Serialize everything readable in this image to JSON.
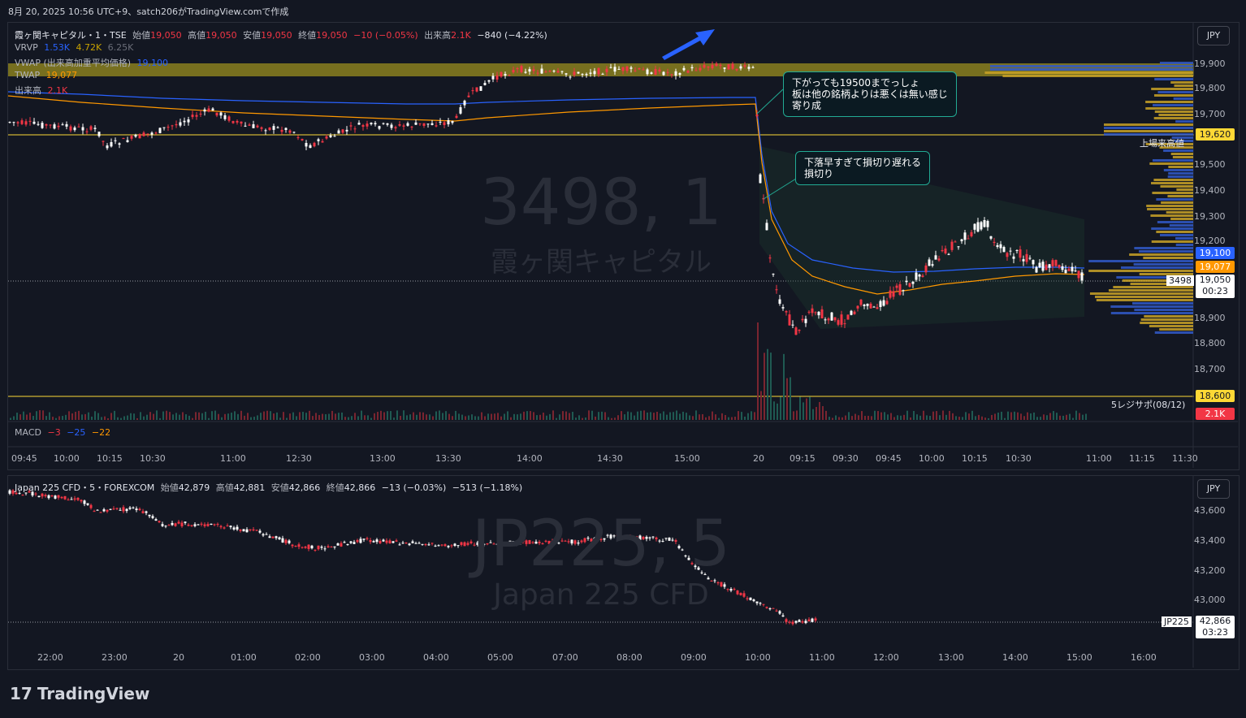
{
  "header": "8月 20, 2025 10:56 UTC+9、satch206がTradingView.comで作成",
  "top_chart": {
    "currency_button": "JPY",
    "title_symbol": "霞ヶ関キャピタル・1・TSE",
    "ohlc": {
      "open_label": "始値",
      "open": "19,050",
      "high_label": "高値",
      "high": "19,050",
      "low_label": "安値",
      "low": "19,050",
      "close_label": "終値",
      "close": "19,050",
      "change": "−10 (−0.05%)",
      "volume_label": "出来高",
      "volume": "2.1K",
      "day_change": "−840 (−4.22%)"
    },
    "indicators": [
      {
        "name": "VRVP",
        "v1": "1.53K",
        "v2": "4.72K",
        "v3": "6.25K"
      },
      {
        "name": "VWAP (出来高加重平均価格)",
        "value": "19,100"
      },
      {
        "name": "TWAP",
        "value": "19,077"
      },
      {
        "name": "出来高",
        "value": "2.1K"
      }
    ],
    "watermark_big": "3498, 1",
    "watermark_small": "霞ヶ関キャピタル",
    "price_axis": [
      "19,900",
      "19,800",
      "19,700",
      "19,600",
      "19,500",
      "19,400",
      "19,300",
      "19,200",
      "18,900",
      "18,800",
      "18,700"
    ],
    "price_tags": {
      "resistance": "19,620",
      "resistance_label": "上場来高値",
      "vwap": "19,100",
      "twap": "19,077",
      "last": "19,050",
      "countdown": "00:23",
      "symbol_tag": "3498",
      "support": "18,600",
      "support_label": "5レジサポ(08/12)",
      "volume": "2.1K"
    },
    "macd": {
      "label": "MACD",
      "v1": "−3",
      "v2": "−25",
      "v3": "−22"
    },
    "time_axis": [
      "09:45",
      "10:00",
      "10:15",
      "10:30",
      "11:00",
      "12:30",
      "13:00",
      "13:30",
      "14:00",
      "14:30",
      "15:00",
      "20",
      "09:15",
      "09:30",
      "09:45",
      "10:00",
      "10:15",
      "10:30",
      "11:00",
      "11:15",
      "11:30"
    ],
    "callout1": "下がっても19500までっしょ\n板は他の銘柄よりは悪くは無い感じ\n寄り成",
    "callout2": "下落早すぎて損切り遅れる\n損切り"
  },
  "bottom_chart": {
    "currency_button": "JPY",
    "title": "Japan 225 CFD・5・FOREXCOM",
    "ohlc": {
      "open_label": "始値",
      "open": "42,879",
      "high_label": "高値",
      "high": "42,881",
      "low_label": "安値",
      "low": "42,866",
      "close_label": "終値",
      "close": "42,866",
      "change": "−13 (−0.03%)",
      "day_change": "−513 (−1.18%)"
    },
    "watermark_big": "JP225, 5",
    "watermark_small": "Japan 225 CFD",
    "price_axis": [
      "43,600",
      "43,400",
      "43,200",
      "43,000"
    ],
    "price_tags": {
      "symbol_tag": "JP225",
      "last": "42,866",
      "countdown": "03:23"
    },
    "time_axis": [
      "22:00",
      "23:00",
      "20",
      "01:00",
      "02:00",
      "03:00",
      "04:00",
      "05:00",
      "07:00",
      "08:00",
      "09:00",
      "10:00",
      "11:00",
      "12:00",
      "13:00",
      "14:00",
      "15:00",
      "16:00"
    ]
  },
  "logo": "TradingView",
  "colors": {
    "up": "#f23645",
    "down": "#ffffff",
    "vwap": "#2962ff",
    "twap": "#ff9800",
    "resistance_band": "#a59a2a",
    "line": "#fdd835"
  }
}
